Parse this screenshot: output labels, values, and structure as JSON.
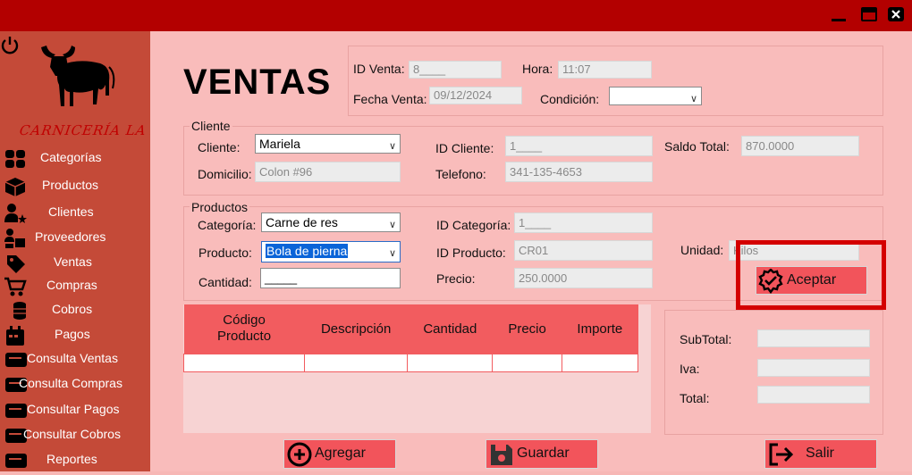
{
  "window": {
    "title": "",
    "controls": [
      "minimize-icon",
      "maximize-icon",
      "close-icon"
    ]
  },
  "sidebar": {
    "brand": "CARNICERÍA LA XVI",
    "items": [
      {
        "label": "Categorías",
        "icon": "grid-icon"
      },
      {
        "label": "Productos",
        "icon": "box-icon"
      },
      {
        "label": "Clientes",
        "icon": "users-star-icon"
      },
      {
        "label": "Proveedores",
        "icon": "supplier-icon"
      },
      {
        "label": "Ventas",
        "icon": "tag-icon"
      },
      {
        "label": "Compras",
        "icon": "cart-icon"
      },
      {
        "label": "Cobros",
        "icon": "coins-icon"
      },
      {
        "label": "Pagos",
        "icon": "calendar-pay-icon"
      },
      {
        "label": "Consulta Ventas",
        "icon": "report-icon"
      },
      {
        "label": "Consulta Compras",
        "icon": "report-icon"
      },
      {
        "label": "Consultar Pagos",
        "icon": "report-icon"
      },
      {
        "label": "Consultar Cobros",
        "icon": "report-icon"
      },
      {
        "label": "Reportes",
        "icon": "report-icon"
      }
    ]
  },
  "header": {
    "title": "VENTAS",
    "id_venta_label": "ID Venta:",
    "id_venta_value": "8____",
    "hora_label": "Hora:",
    "hora_value": "11:07",
    "fecha_label": "Fecha Venta:",
    "fecha_value": "09/12/2024",
    "condicion_label": "Condición:",
    "condicion_value": ""
  },
  "cliente": {
    "group_label": "Cliente",
    "cliente_label": "Cliente:",
    "cliente_value": "Mariela",
    "id_cliente_label": "ID Cliente:",
    "id_cliente_value": "1____",
    "saldo_label": "Saldo Total:",
    "saldo_value": "870.0000",
    "domicilio_label": "Domicilio:",
    "domicilio_value": "Colon #96",
    "telefono_label": "Telefono:",
    "telefono_value": "341-135-4653"
  },
  "productos": {
    "group_label": "Productos",
    "categoria_label": "Categoría:",
    "categoria_value": "Carne de res",
    "id_categoria_label": "ID Categoría:",
    "id_categoria_value": "1____",
    "producto_label": "Producto:",
    "producto_value": "Bola de pierna",
    "id_producto_label": "ID Producto:",
    "id_producto_value": "CR01",
    "unidad_label": "Unidad:",
    "unidad_value": "Kilos",
    "cantidad_label": "Cantidad:",
    "cantidad_value": "_____",
    "precio_label": "Precio:",
    "precio_value": "250.0000",
    "aceptar_label": "Aceptar"
  },
  "table": {
    "headers": [
      "Código\nProducto",
      "Descripción",
      "Cantidad",
      "Precio",
      "Importe"
    ],
    "rows": []
  },
  "totals": {
    "subtotal_label": "SubTotal:",
    "iva_label": "Iva:",
    "total_label": "Total:",
    "subtotal_value": "",
    "iva_value": "",
    "total_value": ""
  },
  "actions": {
    "agregar_label": "Agregar",
    "guardar_label": "Guardar",
    "salir_label": "Salir"
  },
  "colors": {
    "titlebar": "#b30000",
    "sidebar": "#c44a38",
    "main_bg": "#f9bcbb",
    "accent_button": "#f2545b",
    "table_header": "#f25c5f",
    "highlight": "#d40000"
  }
}
